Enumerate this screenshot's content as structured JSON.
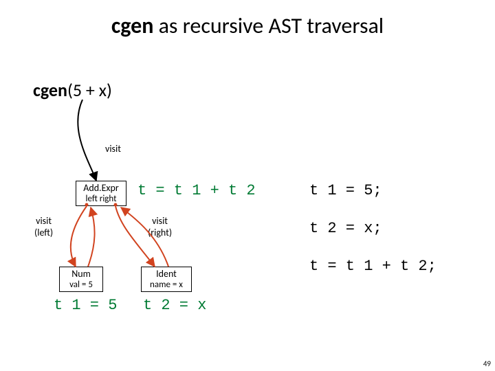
{
  "title": {
    "bold": "cgen",
    "rest": " as recursive AST traversal"
  },
  "expr": {
    "bold": "cgen",
    "rest": "(5 + x)"
  },
  "labels": {
    "visit": "visit",
    "visit_left": "visit\n(left)",
    "visit_right": "visit\n(right)"
  },
  "nodes": {
    "root": {
      "line1": "Add.Expr",
      "line2": "left  right"
    },
    "left": {
      "line1": "Num",
      "line2": "val = 5"
    },
    "right": {
      "line1": "Ident",
      "line2": "name = x"
    }
  },
  "code": {
    "root_t": "t = t 1 + t 2",
    "r1": "t 1 = 5;",
    "r2": "t 2 = x;",
    "r3": "t = t 1 + t 2;",
    "left_t": "t 1 = 5",
    "right_t": "t 2 = x"
  },
  "slide_number": "49"
}
